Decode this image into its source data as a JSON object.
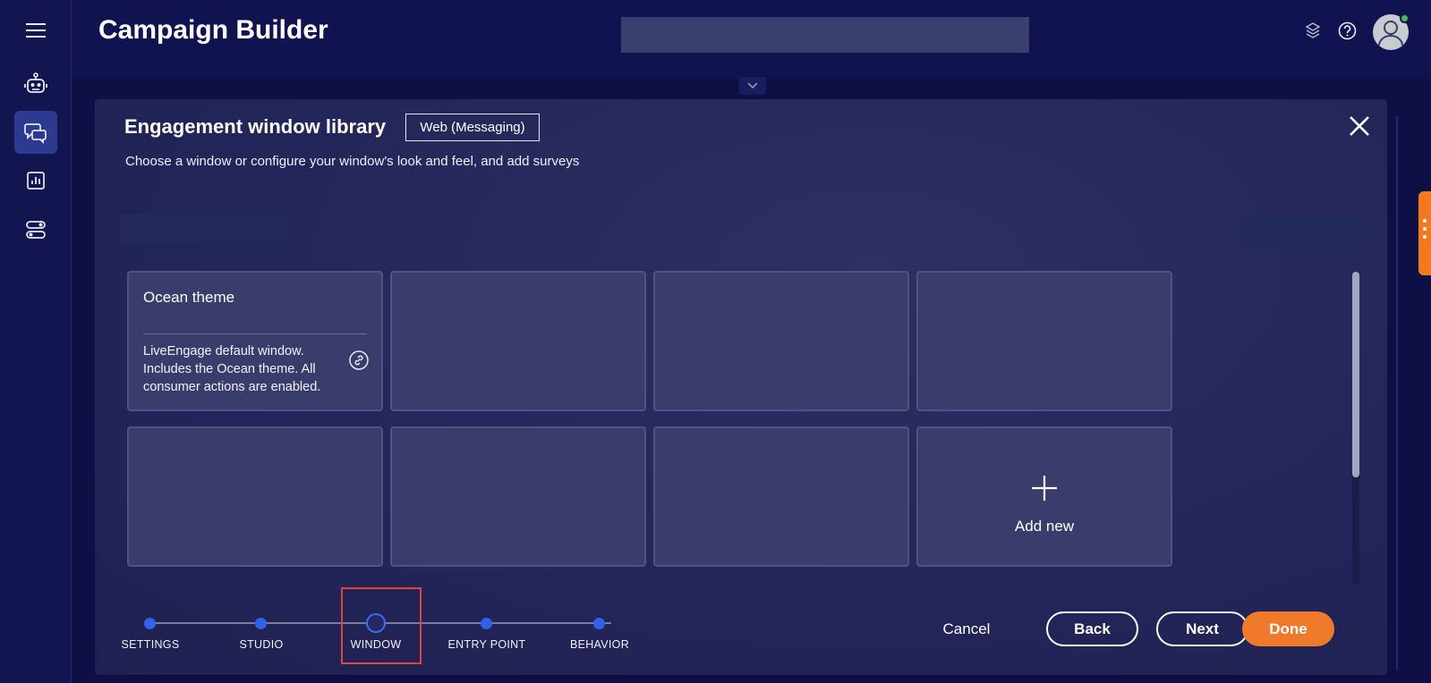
{
  "header": {
    "title": "Campaign Builder"
  },
  "colors": {
    "accent": "#3161e6",
    "primary_button": "#ef7a2a",
    "highlight": "#e3433a",
    "status_online": "#3bbf5b"
  },
  "sidebar": {
    "items": [
      {
        "icon": "menu-icon"
      },
      {
        "icon": "bot-icon"
      },
      {
        "icon": "chat-bubbles-icon",
        "active": true
      },
      {
        "icon": "report-chart-icon"
      },
      {
        "icon": "toggles-icon"
      }
    ]
  },
  "modal": {
    "title": "Engagement window library",
    "channel": "Web (Messaging)",
    "subtitle": "Choose a window or configure your window's look and feel, and add surveys",
    "cards": [
      {
        "title": "Ocean theme",
        "description": "LiveEngage default window. Includes the Ocean theme. All consumer actions are enabled."
      }
    ],
    "add_new_label": "Add new"
  },
  "stepper": {
    "steps": [
      "SETTINGS",
      "STUDIO",
      "WINDOW",
      "ENTRY POINT",
      "BEHAVIOR"
    ],
    "current_index": 2
  },
  "buttons": {
    "cancel": "Cancel",
    "back": "Back",
    "next": "Next",
    "done": "Done"
  }
}
